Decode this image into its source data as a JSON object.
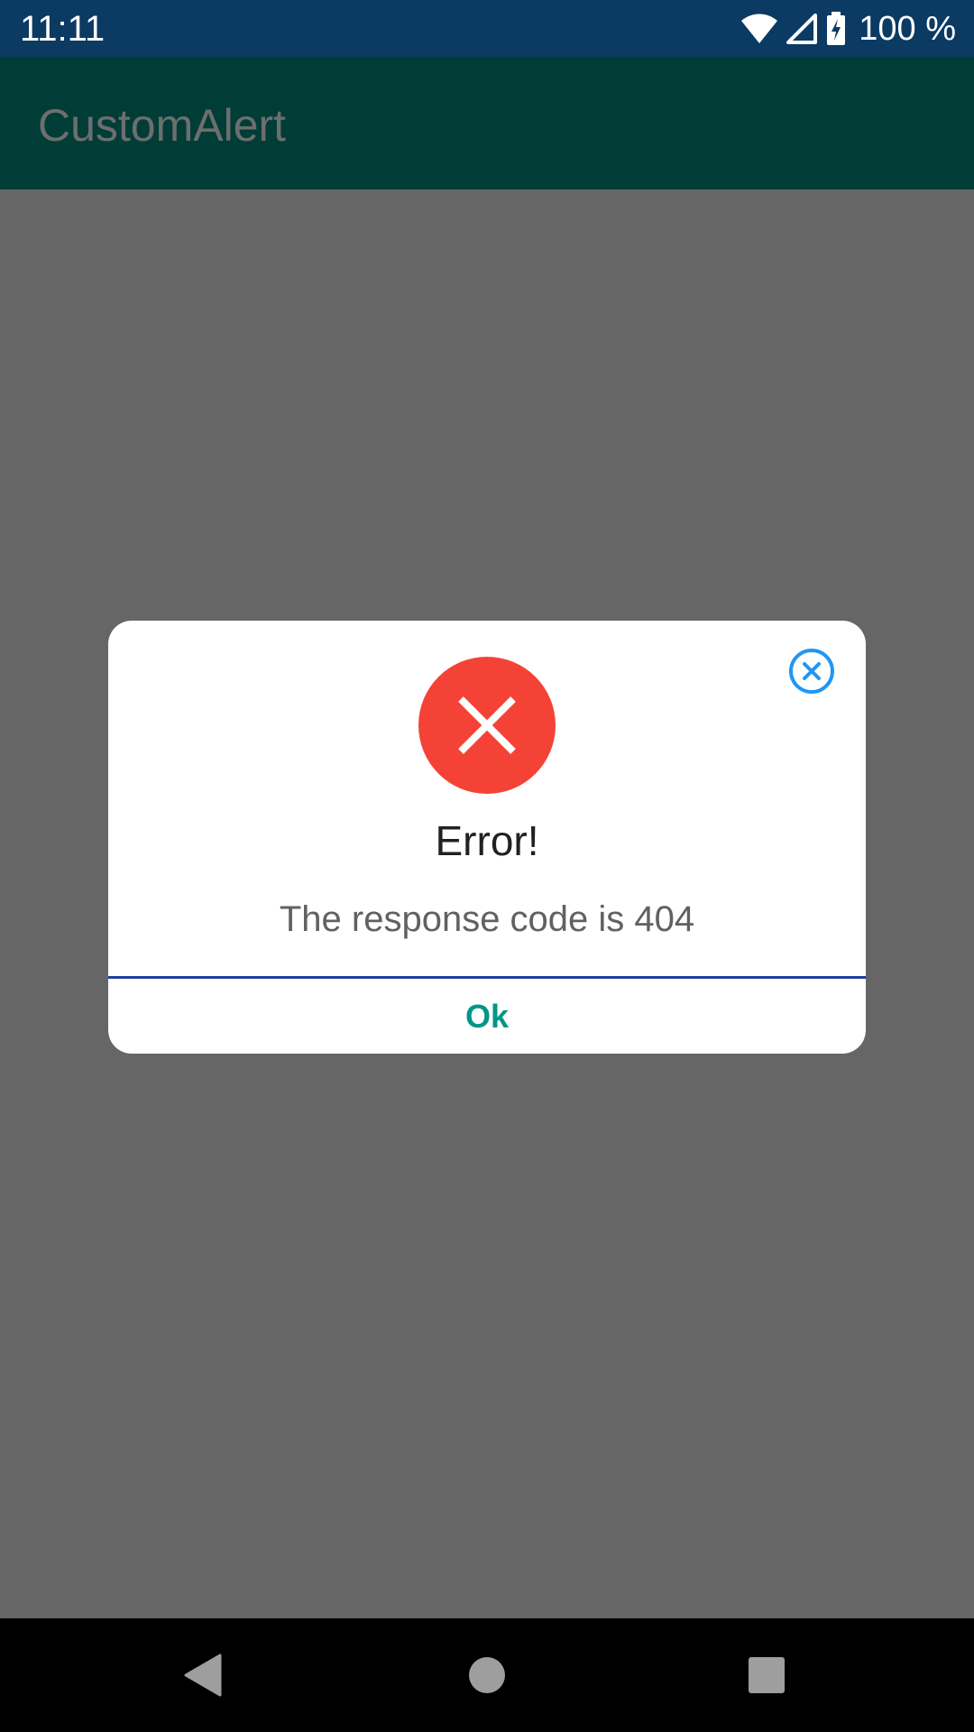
{
  "status_bar": {
    "time": "11:11",
    "battery_text": "100 %",
    "icons": [
      "wifi-icon",
      "signal-icon",
      "battery-charging-icon"
    ]
  },
  "app_bar": {
    "title": "CustomAlert"
  },
  "dialog": {
    "icon": "error-x-icon",
    "title": "Error!",
    "message": "The response code is 404",
    "ok_label": "Ok",
    "close_icon": "close-circle-icon"
  },
  "nav_bar": {
    "icons": [
      "back-icon",
      "home-icon",
      "recents-icon"
    ]
  },
  "colors": {
    "status_bar": "#0b3a63",
    "app_bar_dimmed": "#003d37",
    "scrim": "#666666",
    "error_red": "#f44336",
    "close_blue": "#2196f3",
    "divider_blue": "#1e3fa0",
    "ok_teal": "#009688"
  }
}
